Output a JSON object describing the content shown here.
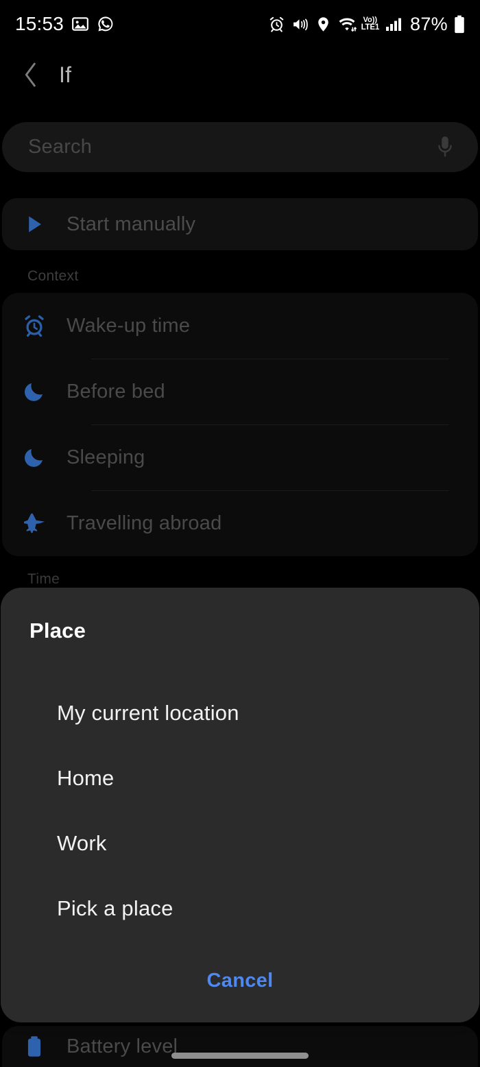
{
  "status_bar": {
    "time": "15:53",
    "battery_percent": "87%",
    "network_label_top": "Vo))",
    "network_label_bottom": "LTE1",
    "left_icons": [
      "image-icon",
      "whatsapp-icon"
    ],
    "right_icons": [
      "alarm-icon",
      "mute-vibrate-icon",
      "location-icon",
      "wifi-icon",
      "volte-icon",
      "signal-bars-icon",
      "battery-icon"
    ]
  },
  "app_bar": {
    "back_icon": "back-chevron-icon",
    "title": "If"
  },
  "search": {
    "placeholder": "Search",
    "value": "",
    "mic_icon": "microphone-icon"
  },
  "start_manually": {
    "label": "Start manually",
    "icon": "play-icon"
  },
  "sections": [
    {
      "label": "Context",
      "items": [
        {
          "label": "Wake-up time",
          "icon": "alarm-clock-icon"
        },
        {
          "label": "Before bed",
          "icon": "moon-icon"
        },
        {
          "label": "Sleeping",
          "icon": "moon-icon"
        },
        {
          "label": "Travelling abroad",
          "icon": "airplane-icon"
        }
      ]
    },
    {
      "label": "Time",
      "items": []
    }
  ],
  "bottom_partial_row": {
    "label": "Battery level",
    "icon": "battery-icon"
  },
  "dialog": {
    "title": "Place",
    "options": [
      {
        "label": "My current location"
      },
      {
        "label": "Home"
      },
      {
        "label": "Work"
      },
      {
        "label": "Pick a place"
      }
    ],
    "cancel_label": "Cancel"
  },
  "colors": {
    "accent_blue": "#4f88ef",
    "icon_blue": "#2b5fa8",
    "dialog_bg": "#2b2b2b",
    "screen_bg": "#000000",
    "card_bg": "#0c0c0c"
  }
}
